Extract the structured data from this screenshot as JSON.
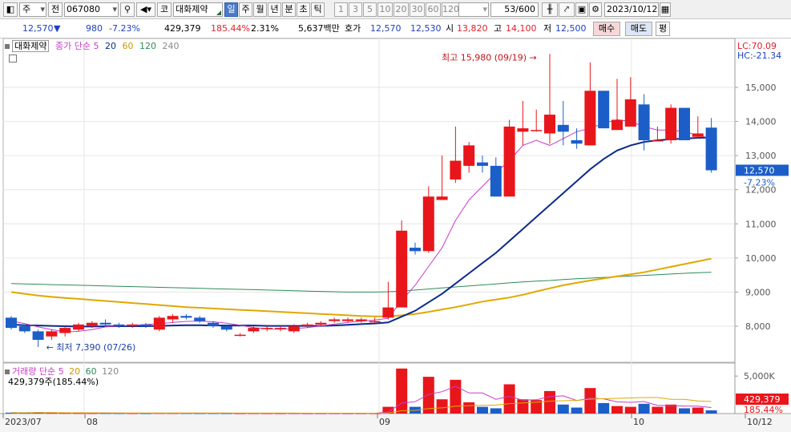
{
  "toolbar": {
    "type_label": "주",
    "market_label": "전",
    "code": "067080",
    "kospi_label": "코",
    "stock_name": "대화제약",
    "periods": [
      "일",
      "주",
      "월",
      "년",
      "분",
      "초",
      "틱"
    ],
    "active_period": "일",
    "intervals": [
      "1",
      "3",
      "5",
      "10",
      "20",
      "30",
      "60",
      "120"
    ],
    "count_value": "53/600",
    "date_value": "2023/10/12"
  },
  "quote": {
    "price": "12,570",
    "change": "980",
    "change_pct": "-7.23%",
    "volume": "429,379",
    "volume_ratio": "185.44%",
    "turnover_pct": "2.31%",
    "amount": "5,637백만",
    "ask_label": "호가",
    "ask": "12,570",
    "bid": "12,530",
    "open_label": "시",
    "open": "13,820",
    "high_label": "고",
    "high": "14,100",
    "low_label": "저",
    "low": "12,500",
    "buy_label": "매수",
    "sell_label": "매도",
    "eval_label": "평"
  },
  "legend": {
    "name": "대화제약",
    "series_label": "종가 단순",
    "ma": [
      "5",
      "20",
      "60",
      "120",
      "240"
    ],
    "lc": "LC:70.09",
    "hc": "HC:-21.34"
  },
  "volume_legend": {
    "label": "거래량 단순",
    "ma": [
      "5",
      "20",
      "60",
      "120"
    ],
    "value": "429,379주(185.44%)"
  },
  "annotations": {
    "high_text": "최고 15,980 (09/19)",
    "low_text": "최저 7,390 (07/26)"
  },
  "price_badge": {
    "price": "12,570",
    "pct": "-7.23%"
  },
  "volume_badge": {
    "value": "429,379",
    "pct": "185.44%"
  },
  "colors": {
    "up": "#e8161b",
    "down": "#1b5ec8",
    "ma5": "#c83cc8",
    "ma20": "#0c2a8c",
    "ma60": "#e0a800",
    "ma120": "#2e8b57",
    "ma240": "#888888"
  },
  "chart_data": {
    "type": "candlestick",
    "price_axis_ticks": [
      "15,000",
      "14,000",
      "13,000",
      "12,000",
      "11,000",
      "10,000",
      "9,000",
      "8,000"
    ],
    "volume_axis_ticks": [
      "5,000K"
    ],
    "x_labels": [
      "2023/07",
      "08",
      "09",
      "10",
      "10/12"
    ],
    "candles": [
      {
        "o": 8250,
        "h": 8300,
        "l": 7900,
        "c": 7950
      },
      {
        "o": 8000,
        "h": 8050,
        "l": 7800,
        "c": 7850
      },
      {
        "o": 7850,
        "h": 7900,
        "l": 7390,
        "c": 7600
      },
      {
        "o": 7700,
        "h": 7900,
        "l": 7600,
        "c": 7850
      },
      {
        "o": 7800,
        "h": 8000,
        "l": 7700,
        "c": 7950
      },
      {
        "o": 7900,
        "h": 8100,
        "l": 7850,
        "c": 8050
      },
      {
        "o": 8000,
        "h": 8150,
        "l": 7950,
        "c": 8100
      },
      {
        "o": 8100,
        "h": 8200,
        "l": 8000,
        "c": 8050
      },
      {
        "o": 8050,
        "h": 8100,
        "l": 7950,
        "c": 8000
      },
      {
        "o": 8000,
        "h": 8100,
        "l": 7950,
        "c": 8050
      },
      {
        "o": 8050,
        "h": 8100,
        "l": 7950,
        "c": 8000
      },
      {
        "o": 7900,
        "h": 8300,
        "l": 7850,
        "c": 8250
      },
      {
        "o": 8200,
        "h": 8350,
        "l": 8100,
        "c": 8300
      },
      {
        "o": 8300,
        "h": 8350,
        "l": 8200,
        "c": 8250
      },
      {
        "o": 8250,
        "h": 8300,
        "l": 8100,
        "c": 8150
      },
      {
        "o": 8100,
        "h": 8150,
        "l": 7950,
        "c": 8000
      },
      {
        "o": 8000,
        "h": 8050,
        "l": 7850,
        "c": 7900
      },
      {
        "o": 7750,
        "h": 7800,
        "l": 7700,
        "c": 7750
      },
      {
        "o": 7850,
        "h": 8000,
        "l": 7800,
        "c": 7950
      },
      {
        "o": 7950,
        "h": 8000,
        "l": 7850,
        "c": 7950
      },
      {
        "o": 7950,
        "h": 8000,
        "l": 7850,
        "c": 7950
      },
      {
        "o": 7850,
        "h": 8050,
        "l": 7800,
        "c": 8000
      },
      {
        "o": 8000,
        "h": 8100,
        "l": 7950,
        "c": 8050
      },
      {
        "o": 8050,
        "h": 8150,
        "l": 8000,
        "c": 8100
      },
      {
        "o": 8150,
        "h": 8250,
        "l": 8100,
        "c": 8200
      },
      {
        "o": 8150,
        "h": 8250,
        "l": 8100,
        "c": 8200
      },
      {
        "o": 8150,
        "h": 8250,
        "l": 8100,
        "c": 8200
      },
      {
        "o": 8150,
        "h": 8250,
        "l": 8100,
        "c": 8150
      },
      {
        "o": 8250,
        "h": 9300,
        "l": 8200,
        "c": 8550
      },
      {
        "o": 8550,
        "h": 11100,
        "l": 8550,
        "c": 10800
      },
      {
        "o": 10300,
        "h": 10450,
        "l": 10100,
        "c": 10200
      },
      {
        "o": 10200,
        "h": 12100,
        "l": 10150,
        "c": 11800
      },
      {
        "o": 11700,
        "h": 13000,
        "l": 11700,
        "c": 11800
      },
      {
        "o": 12300,
        "h": 13850,
        "l": 12200,
        "c": 12850
      },
      {
        "o": 12700,
        "h": 13400,
        "l": 12500,
        "c": 13300
      },
      {
        "o": 12800,
        "h": 13000,
        "l": 12500,
        "c": 12700
      },
      {
        "o": 12700,
        "h": 12950,
        "l": 11800,
        "c": 11800
      },
      {
        "o": 11800,
        "h": 14050,
        "l": 11800,
        "c": 13850
      },
      {
        "o": 13700,
        "h": 14600,
        "l": 13300,
        "c": 13800
      },
      {
        "o": 13750,
        "h": 14350,
        "l": 13700,
        "c": 13750
      },
      {
        "o": 13650,
        "h": 15980,
        "l": 13350,
        "c": 14200
      },
      {
        "o": 13900,
        "h": 14600,
        "l": 13300,
        "c": 13700
      },
      {
        "o": 13450,
        "h": 13800,
        "l": 13200,
        "c": 13350
      },
      {
        "o": 13300,
        "h": 15730,
        "l": 13300,
        "c": 14900
      },
      {
        "o": 14900,
        "h": 14900,
        "l": 13800,
        "c": 13800
      },
      {
        "o": 13750,
        "h": 15250,
        "l": 13750,
        "c": 14050
      },
      {
        "o": 13850,
        "h": 15300,
        "l": 13850,
        "c": 14650
      },
      {
        "o": 14500,
        "h": 14800,
        "l": 13150,
        "c": 13450
      },
      {
        "o": 13450,
        "h": 13850,
        "l": 13450,
        "c": 13450
      },
      {
        "o": 13450,
        "h": 14500,
        "l": 13350,
        "c": 14400
      },
      {
        "o": 14400,
        "h": 14400,
        "l": 13450,
        "c": 13450
      },
      {
        "o": 13550,
        "h": 14150,
        "l": 13500,
        "c": 13650
      },
      {
        "o": 13820,
        "h": 14100,
        "l": 12500,
        "c": 12570
      }
    ],
    "ma": {
      "ma5": [
        8150,
        8080,
        7980,
        7900,
        7830,
        7850,
        7900,
        7980,
        8010,
        8030,
        8050,
        8070,
        8110,
        8140,
        8150,
        8130,
        8090,
        8030,
        7960,
        7920,
        7910,
        7930,
        7960,
        8010,
        8060,
        8110,
        8150,
        8180,
        8230,
        8750,
        9200,
        9750,
        10300,
        11100,
        11700,
        12100,
        12500,
        12850,
        13300,
        13450,
        13300,
        13500,
        13700,
        13800,
        13950,
        14050,
        14000,
        13850,
        13750,
        13750,
        13700,
        13600,
        13500
      ],
      "ma20": [
        8050,
        8030,
        8020,
        8010,
        8000,
        7990,
        7990,
        8000,
        8000,
        8000,
        8000,
        8010,
        8020,
        8030,
        8030,
        8020,
        8020,
        8020,
        8020,
        8010,
        8010,
        8010,
        8010,
        8010,
        8020,
        8040,
        8060,
        8080,
        8110,
        8280,
        8450,
        8700,
        8950,
        9250,
        9550,
        9850,
        10150,
        10500,
        10850,
        11200,
        11550,
        11900,
        12250,
        12600,
        12900,
        13150,
        13300,
        13400,
        13450,
        13480,
        13500,
        13520,
        13530
      ],
      "ma60": [
        9000,
        8950,
        8900,
        8860,
        8830,
        8800,
        8770,
        8740,
        8710,
        8680,
        8650,
        8620,
        8590,
        8560,
        8540,
        8520,
        8500,
        8480,
        8460,
        8440,
        8420,
        8400,
        8380,
        8360,
        8340,
        8320,
        8300,
        8290,
        8290,
        8320,
        8360,
        8420,
        8490,
        8560,
        8640,
        8720,
        8780,
        8840,
        8920,
        9020,
        9110,
        9200,
        9270,
        9340,
        9400,
        9460,
        9520,
        9580,
        9660,
        9740,
        9820,
        9900,
        9980
      ],
      "ma120": [
        9250,
        9240,
        9230,
        9220,
        9210,
        9200,
        9190,
        9180,
        9170,
        9160,
        9150,
        9140,
        9130,
        9120,
        9110,
        9100,
        9090,
        9080,
        9070,
        9060,
        9050,
        9040,
        9030,
        9020,
        9010,
        9000,
        9000,
        9000,
        9010,
        9030,
        9060,
        9090,
        9120,
        9150,
        9180,
        9210,
        9240,
        9270,
        9300,
        9320,
        9340,
        9370,
        9390,
        9410,
        9430,
        9450,
        9470,
        9490,
        9510,
        9530,
        9550,
        9570,
        9580
      ]
    },
    "volume_k": [
      120,
      100,
      150,
      90,
      80,
      70,
      60,
      60,
      50,
      50,
      45,
      70,
      60,
      55,
      50,
      50,
      45,
      40,
      45,
      40,
      40,
      45,
      40,
      40,
      45,
      40,
      40,
      40,
      900,
      6000,
      900,
      4900,
      1900,
      4500,
      1500,
      900,
      700,
      3900,
      1900,
      1800,
      3000,
      1200,
      800,
      3400,
      1400,
      1000,
      900,
      1300,
      900,
      1200,
      700,
      800,
      429
    ]
  }
}
